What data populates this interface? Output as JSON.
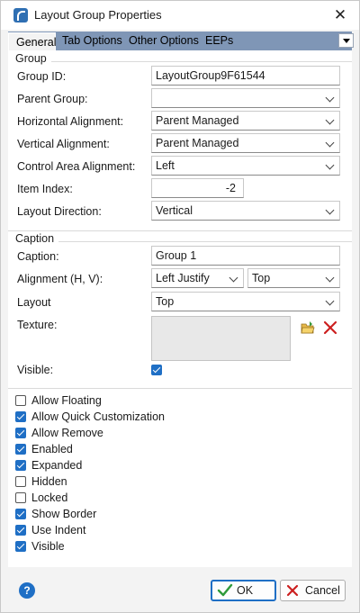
{
  "window": {
    "title": "Layout Group Properties",
    "close_glyph": "✕"
  },
  "tabs": [
    {
      "label": "General",
      "active": true
    },
    {
      "label": "Tab Options",
      "active": false
    },
    {
      "label": "Other Options",
      "active": false
    },
    {
      "label": "EEPs",
      "active": false
    }
  ],
  "group": {
    "section_label": "Group",
    "group_id": {
      "label": "Group ID:",
      "value": "LayoutGroup9F61544"
    },
    "parent_group": {
      "label": "Parent Group:",
      "value": ""
    },
    "horizontal_alignment": {
      "label": "Horizontal Alignment:",
      "value": "Parent Managed"
    },
    "vertical_alignment": {
      "label": "Vertical Alignment:",
      "value": "Parent Managed"
    },
    "control_area_alignment": {
      "label": "Control Area Alignment:",
      "value": "Left"
    },
    "item_index": {
      "label": "Item Index:",
      "value": "-2"
    },
    "layout_direction": {
      "label": "Layout Direction:",
      "value": "Vertical"
    }
  },
  "caption": {
    "section_label": "Caption",
    "caption": {
      "label": "Caption:",
      "value": "Group 1"
    },
    "alignment": {
      "label": "Alignment (H, V):",
      "h_value": "Left Justify",
      "v_value": "Top"
    },
    "layout": {
      "label": "Layout",
      "value": "Top"
    },
    "texture": {
      "label": "Texture:"
    },
    "visible": {
      "label": "Visible:",
      "checked": true
    }
  },
  "options": [
    {
      "label": "Allow Floating",
      "checked": false
    },
    {
      "label": "Allow Quick Customization",
      "checked": true
    },
    {
      "label": "Allow Remove",
      "checked": true
    },
    {
      "label": "Enabled",
      "checked": true
    },
    {
      "label": "Expanded",
      "checked": true
    },
    {
      "label": "Hidden",
      "checked": false
    },
    {
      "label": "Locked",
      "checked": false
    },
    {
      "label": "Show Border",
      "checked": true
    },
    {
      "label": "Use Indent",
      "checked": true
    },
    {
      "label": "Visible",
      "checked": true
    }
  ],
  "footer": {
    "help_glyph": "?",
    "ok_label": "OK",
    "cancel_label": "Cancel"
  },
  "colors": {
    "accent": "#1f6fc5",
    "tab_strip": "#7f96b6",
    "delete": "#cc1f1f"
  }
}
